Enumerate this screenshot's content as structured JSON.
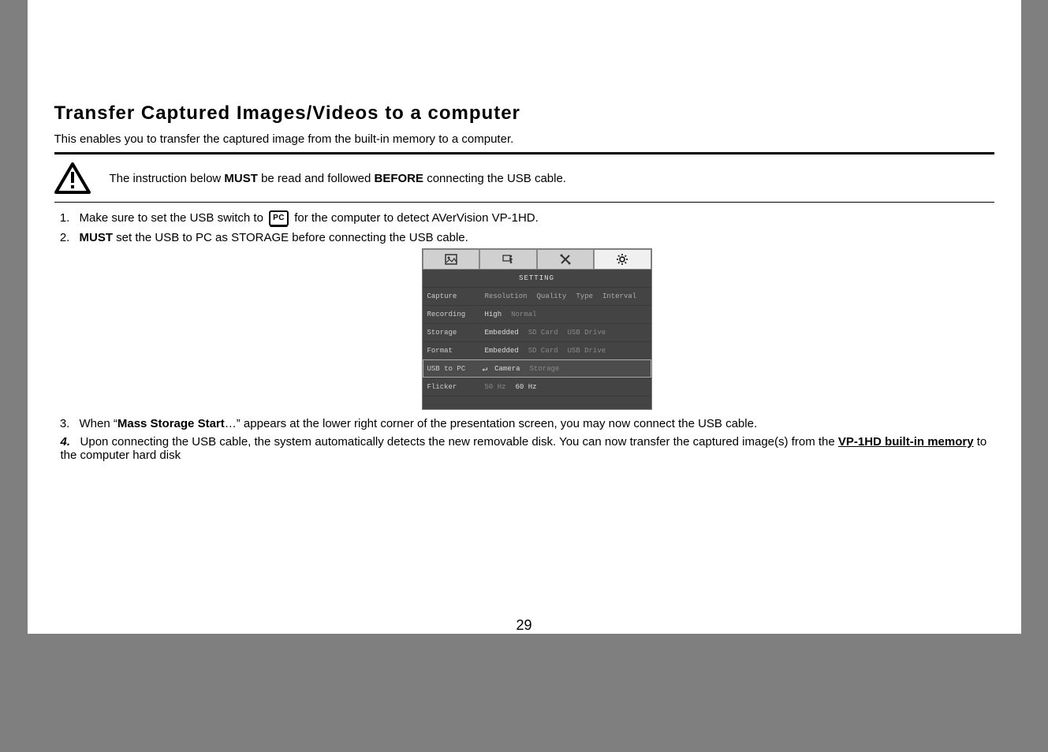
{
  "title": "Transfer Captured Images/Videos to a computer",
  "intro": "This enables you to transfer the captured image from the built-in memory to a computer.",
  "warning": {
    "pre": "The instruction below ",
    "must": "MUST",
    "mid": " be read and followed ",
    "before": "BEFORE",
    "post": " connecting the USB cable."
  },
  "steps": {
    "s1": {
      "pre": "Make sure to set the USB switch to ",
      "chip": "PC",
      "post": " for the computer to detect AVerVision VP-1HD."
    },
    "s2": {
      "must": "MUST",
      "rest": " set the USB to PC as STORAGE before connecting the USB cable."
    },
    "s3": {
      "pre": "When “",
      "bold": "Mass Storage Start",
      "post": "…” appears at the lower right corner of the presentation screen, you may now connect the USB cable."
    },
    "s4": {
      "num": "4.",
      "pre": "Upon connecting the USB cable, the system automatically detects the new removable disk. You can now transfer the captured image(s) from the ",
      "u": "VP-1HD built-in memory",
      "post": " to the computer hard disk"
    }
  },
  "settings": {
    "title": "SETTING",
    "rows": {
      "capture": {
        "label": "Capture",
        "opts": [
          "Resolution",
          "Quality",
          "Type",
          "Interval"
        ]
      },
      "recording": {
        "label": "Recording",
        "opts": [
          "High",
          "Normal"
        ]
      },
      "storage": {
        "label": "Storage",
        "opts": [
          "Embedded",
          "SD Card",
          "USB Drive"
        ]
      },
      "format": {
        "label": "Format",
        "opts": [
          "Embedded",
          "SD Card",
          "USB Drive"
        ]
      },
      "usb": {
        "label": "USB to PC",
        "opts": [
          "Camera",
          "Storage"
        ]
      },
      "flicker": {
        "label": "Flicker",
        "opts": [
          "50 Hz",
          "60 Hz"
        ]
      }
    }
  },
  "page_number": "29"
}
